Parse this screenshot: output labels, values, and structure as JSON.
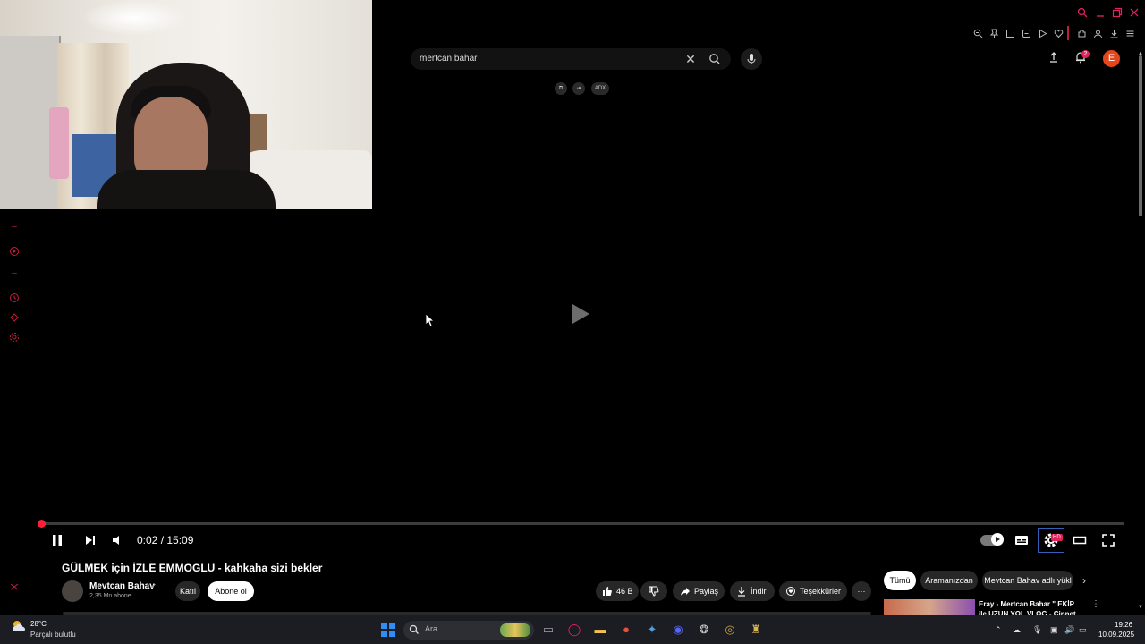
{
  "window": {
    "controls": [
      "search-icon",
      "minimize-icon",
      "restore-icon",
      "close-icon"
    ],
    "accent_color": "#e0245e"
  },
  "toolbar": {
    "icons": [
      "zoom-icon",
      "pin-icon",
      "screenshot-icon",
      "shield-icon",
      "play-icon",
      "heart-icon",
      "extensions-icon",
      "profile-sync-icon",
      "download-icon",
      "menu-icon"
    ]
  },
  "search": {
    "value": "mertcan bahar"
  },
  "header": {
    "notification_count": "2",
    "avatar_letter": "E",
    "avatar_color": "#e6461c"
  },
  "extensions": {
    "items": [
      "copy-icon",
      "login-icon"
    ],
    "adx_label": "ADX"
  },
  "sidebar": {
    "icons": [
      "divider-icon",
      "youtube-icon",
      "divider-icon",
      "history-icon",
      "share-icon",
      "settings-icon"
    ]
  },
  "player": {
    "time": "0:02 / 15:09",
    "progress_fraction": 0.0022,
    "hd_badge": "HD",
    "progress_color": "#f0203a"
  },
  "video": {
    "title": "GÜLMEK için İZLE EMMOGLU - kahkaha sizi bekler",
    "channel_name": "Mevtcan Bahav",
    "subscriber_count": "2,35 Mn abone",
    "join_label": "Katıl",
    "subscribe_label": "Abone ol",
    "like_count": "46 B",
    "share_label": "Paylaş",
    "download_label": "İndir",
    "thanks_label": "Teşekkürler",
    "more_label": "···"
  },
  "recommendations": {
    "filters": [
      "Tümü",
      "Aramanızdan",
      "Mevtcan Bahav adlı yükl"
    ],
    "first_title": "Eray - Mertcan Bahar \" EKİP ile UZUN YOL VLOG - Cinnet Anla"
  },
  "taskbar": {
    "weather_temp": "28°C",
    "weather_desc": "Parçalı bulutlu",
    "search_placeholder": "Ara",
    "time": "19:26",
    "date": "10.09.2025"
  }
}
